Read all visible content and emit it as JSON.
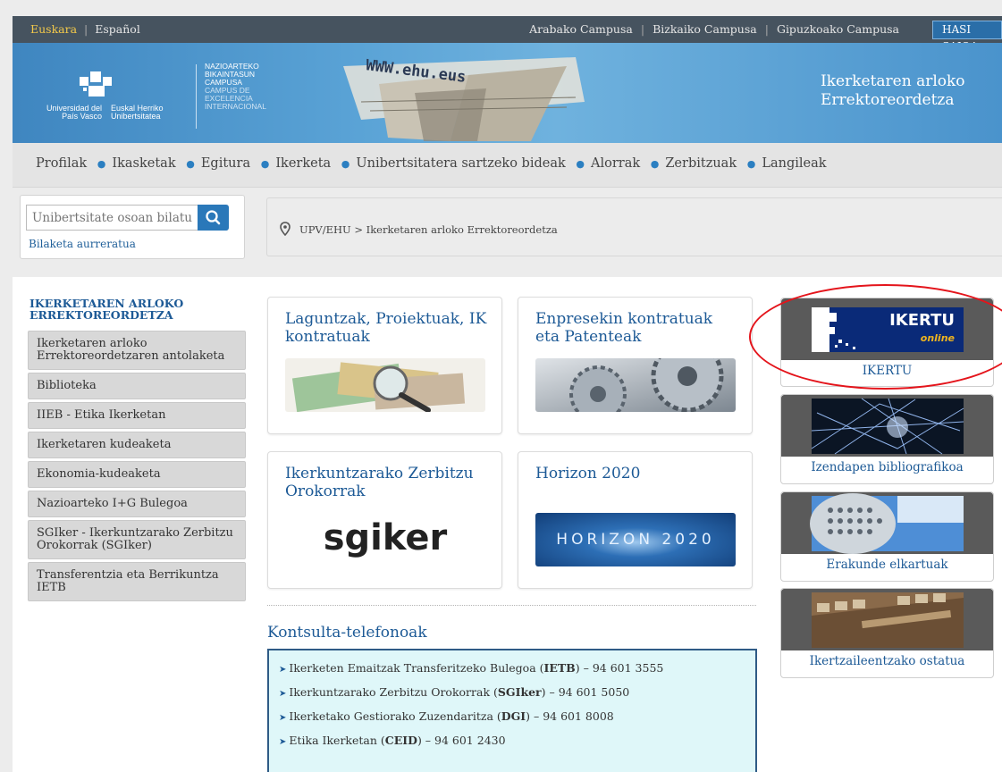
{
  "topbar": {
    "lang_active": "Euskara",
    "lang_other": "Español",
    "campuses": [
      "Arabako Campusa",
      "Bizkaiko Campusa",
      "Gipuzkoako Campusa"
    ],
    "login": "HASI SAIOA"
  },
  "banner": {
    "univ_es": "Universidad del País Vasco",
    "univ_eu": "Euskal Herriko Unibertsitatea",
    "campus_line1": "NAZIOARTEKO BIKAINTASUN CAMPUSA",
    "campus_line2": "CAMPUS DE EXCELENCIA INTERNACIONAL",
    "www": "WWW.ehu.eus",
    "title": "Ikerketaren arloko Errektoreordetza"
  },
  "mainnav": [
    "Profilak",
    "Ikasketak",
    "Egitura",
    "Ikerketa",
    "Unibertsitatera sartzeko bideak",
    "Alorrak",
    "Zerbitzuak",
    "Langileak"
  ],
  "search": {
    "placeholder": "Unibertsitate osoan bilatu",
    "advanced": "Bilaketa aurreratua"
  },
  "breadcrumb": "UPV/EHU > Ikerketaren arloko Errektoreordetza",
  "sidebar": {
    "heading": "IKERKETAREN ARLOKO ERREKTOREORDETZA",
    "items": [
      "Ikerketaren arloko Errektoreordetzaren antolaketa",
      "Biblioteka",
      "IIEB - Etika Ikerketan",
      "Ikerketaren kudeaketa",
      "Ekonomia-kudeaketa",
      "Nazioarteko I+G Bulegoa",
      "SGIker - Ikerkuntzarako Zerbitzu Orokorrak (SGIker)",
      "Transferentzia eta Berrikuntza IETB"
    ]
  },
  "tiles": [
    {
      "title": "Laguntzak, Proiektuak, IK kontratuak"
    },
    {
      "title": "Enpresekin kontratuak eta Patenteak"
    },
    {
      "title": "Ikerkuntzarako Zerbitzu Orokorrak",
      "logo": "sgiker"
    },
    {
      "title": "Horizon 2020",
      "logo": "HORIZON 2020"
    }
  ],
  "phones": {
    "title": "Kontsulta-telefonoak",
    "rows": [
      {
        "pre": "Ikerketen Emaitzak Transferitzeko Bulegoa (",
        "bold": "IETB",
        "post": ") – 94 601 3555"
      },
      {
        "pre": "Ikerkuntzarako Zerbitzu Orokorrak (",
        "bold": "SGIker",
        "post": ") – 94 601 5050"
      },
      {
        "pre": "Ikerketako Gestiorako Zuzendaritza (",
        "bold": "DGI",
        "post": ") – 94 601 8008"
      },
      {
        "pre": "Etika Ikerketan (",
        "bold": "CEID",
        "post": ") – 94 601 2430"
      }
    ]
  },
  "right": [
    {
      "label": "IKERTU",
      "logo1": "IKERTU",
      "logo2": "online"
    },
    {
      "label": "Izendapen bibliografikoa"
    },
    {
      "label": "Erakunde elkartuak"
    },
    {
      "label": "Ikertzaileentzako ostatua"
    }
  ],
  "colors": {
    "accent": "#1d5a96",
    "annotation": "#e4141b"
  }
}
